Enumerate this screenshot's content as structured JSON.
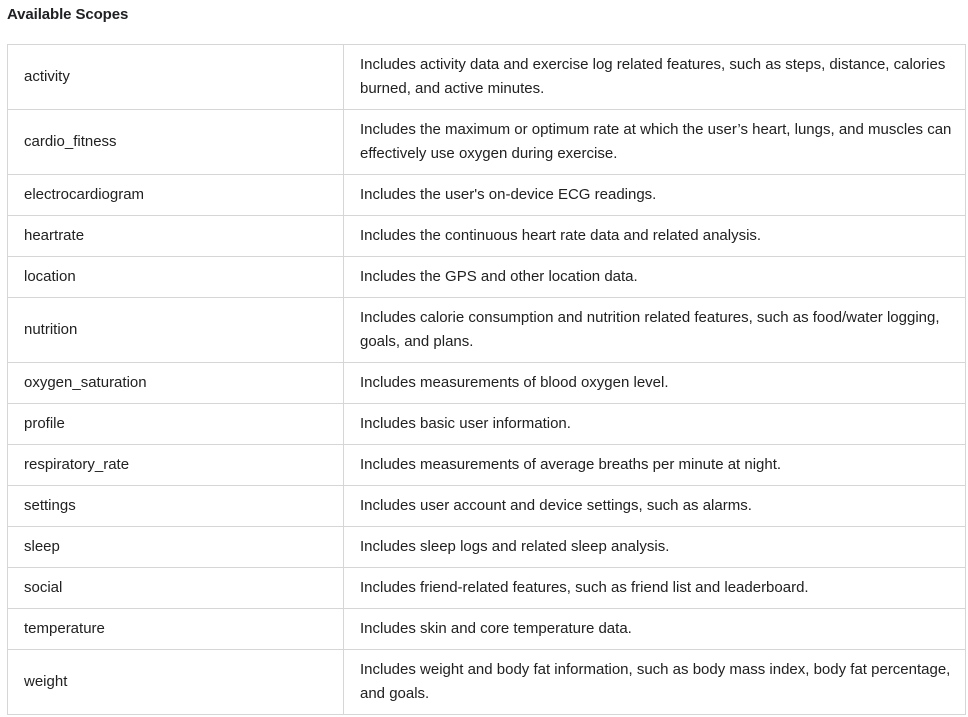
{
  "heading": "Available Scopes",
  "rows": [
    {
      "name": "activity",
      "description": "Includes activity data and exercise log related features, such as steps, distance, calories burned, and active minutes."
    },
    {
      "name": "cardio_fitness",
      "description": "Includes the maximum or optimum rate at which the user’s heart, lungs, and muscles can effectively use oxygen during exercise."
    },
    {
      "name": "electrocardiogram",
      "description": "Includes the user's on-device ECG readings."
    },
    {
      "name": "heartrate",
      "description": "Includes the continuous heart rate data and related analysis."
    },
    {
      "name": "location",
      "description": "Includes the GPS and other location data."
    },
    {
      "name": "nutrition",
      "description": "Includes calorie consumption and nutrition related features, such as food/water logging, goals, and plans."
    },
    {
      "name": "oxygen_saturation",
      "description": "Includes measurements of blood oxygen level."
    },
    {
      "name": "profile",
      "description": "Includes basic user information."
    },
    {
      "name": "respiratory_rate",
      "description": "Includes measurements of average breaths per minute at night."
    },
    {
      "name": "settings",
      "description": "Includes user account and device settings, such as alarms."
    },
    {
      "name": "sleep",
      "description": "Includes sleep logs and related sleep analysis."
    },
    {
      "name": "social",
      "description": "Includes friend-related features, such as friend list and leaderboard."
    },
    {
      "name": "temperature",
      "description": "Includes skin and core temperature data."
    },
    {
      "name": "weight",
      "description": "Includes weight and body fat information, such as body mass index, body fat percentage, and goals."
    }
  ]
}
